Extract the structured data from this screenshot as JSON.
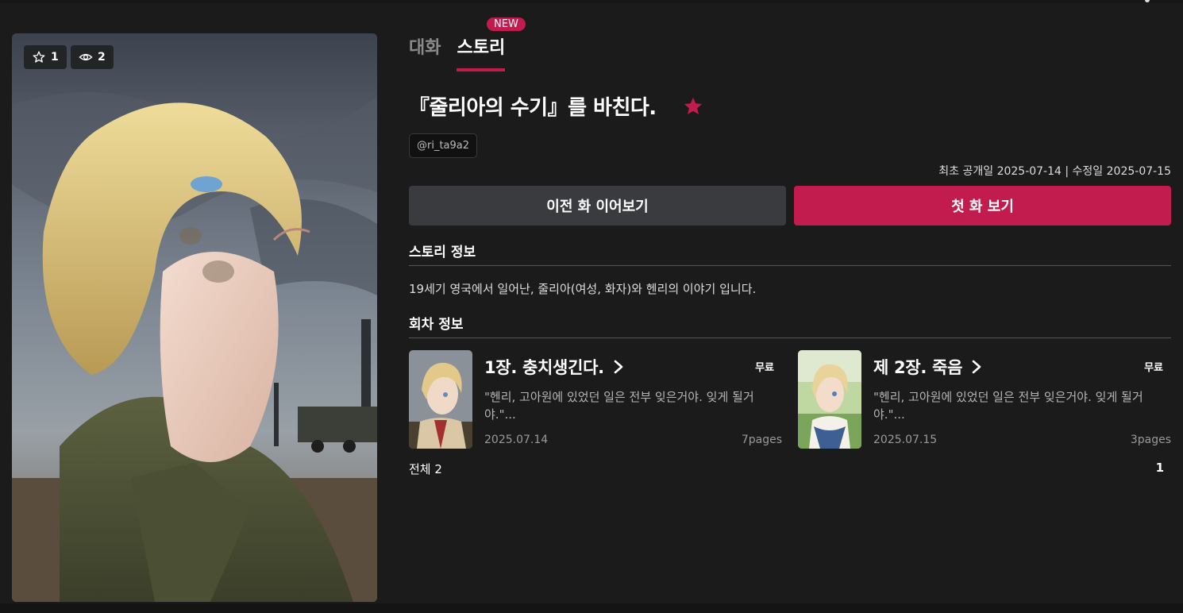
{
  "colors": {
    "background": "#1b1b1b",
    "accent": "#c21c4f",
    "secondary_button": "#3a3b3e"
  },
  "cover": {
    "stars": "1",
    "views": "2",
    "star_icon": "star-outline-icon",
    "view_icon": "eye-icon"
  },
  "tabs": [
    {
      "label": "대화",
      "active": false
    },
    {
      "label": "스토리",
      "active": true
    }
  ],
  "new_badge": "NEW",
  "story": {
    "title": "『줄리아의 수기』를 바친다.",
    "author": "@ri_ta9a2",
    "dates": "최초 공개일 2025-07-14  | 수정일 2025-07-15",
    "favorite_icon": "star-filled-icon"
  },
  "buttons": {
    "prev": "이전 화 이어보기",
    "first": "첫 화 보기"
  },
  "info": {
    "heading": "스토리 정보",
    "synopsis": "19세기 영국에서 일어난, 줄리아(여성, 화자)와 헨리의 이야기 입니다."
  },
  "episodes_section": {
    "heading": "회차 정보",
    "episodes": [
      {
        "title": "1장. 충치생긴다.",
        "price": "무료",
        "desc": "\"헨리, 고아원에 있었던 일은 전부 잊은거야. 잊게 될거야.\"...",
        "date": "2025.07.14",
        "pages": "7pages"
      },
      {
        "title": "제 2장. 죽음",
        "price": "무료",
        "desc": "\"헨리, 고아원에 있었던 일은 전부 잊은거야. 잊게 될거야.\"...",
        "date": "2025.07.15",
        "pages": "3pages"
      }
    ],
    "total": "전체 2",
    "page": "1"
  }
}
